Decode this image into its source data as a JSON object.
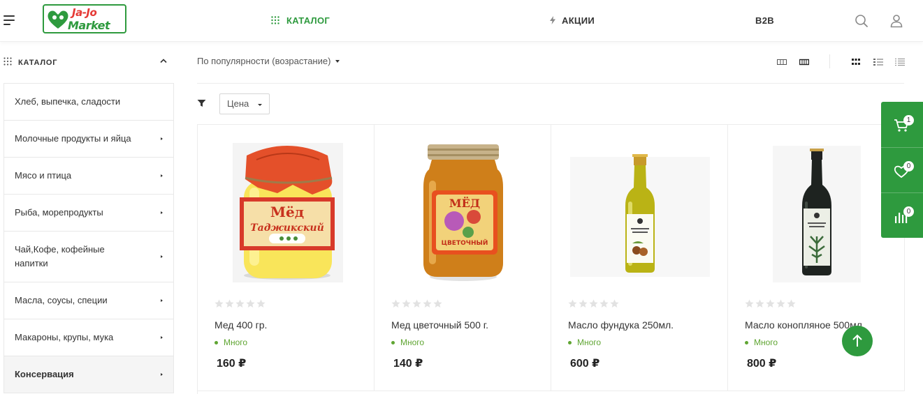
{
  "header": {
    "logo_line1": "Ja-Jo",
    "logo_line2": "Market",
    "nav": {
      "catalog": "КАТАЛОГ",
      "promotions": "АКЦИИ",
      "b2b": "B2B"
    }
  },
  "sidebar": {
    "title": "КАТАЛОГ",
    "items": [
      {
        "label": "Хлеб, выпечка, сладости"
      },
      {
        "label": "Молочные продукты и яйца"
      },
      {
        "label": "Мясо и птица"
      },
      {
        "label": "Рыба, морепродукты"
      },
      {
        "label": "Чай,Кофе, кофейные напитки"
      },
      {
        "label": "Масла, соусы, специи"
      },
      {
        "label": "Макароны, крупы, мука"
      },
      {
        "label": "Консервация"
      }
    ]
  },
  "toolbar": {
    "sort_label": "По популярности (возрастание)",
    "price_filter_label": "Цена"
  },
  "products": [
    {
      "name": "Мед 400 гр.",
      "stock": "Много",
      "price": "160 ₽",
      "rating": 0
    },
    {
      "name": "Мед цветочный 500 г.",
      "stock": "Много",
      "price": "140 ₽",
      "rating": 0
    },
    {
      "name": "Масло фундука 250мл.",
      "stock": "Много",
      "price": "600 ₽",
      "rating": 0
    },
    {
      "name": "Масло конопляное 500мл.",
      "stock": "Много",
      "price": "800 ₽",
      "rating": 0
    }
  ],
  "product_labels": {
    "jar1_word1": "Мёд",
    "jar1_word2": "Таджикский",
    "jar2_word1": "МЁД",
    "jar2_word2": "ЦВЕТОЧНЫЙ"
  },
  "float_panel": {
    "cart_count": "1",
    "wishlist_count": "0",
    "compare_count": "0"
  },
  "colors": {
    "accent": "#2e9a3e",
    "stock": "#5fa532",
    "logo_red": "#e53935"
  }
}
